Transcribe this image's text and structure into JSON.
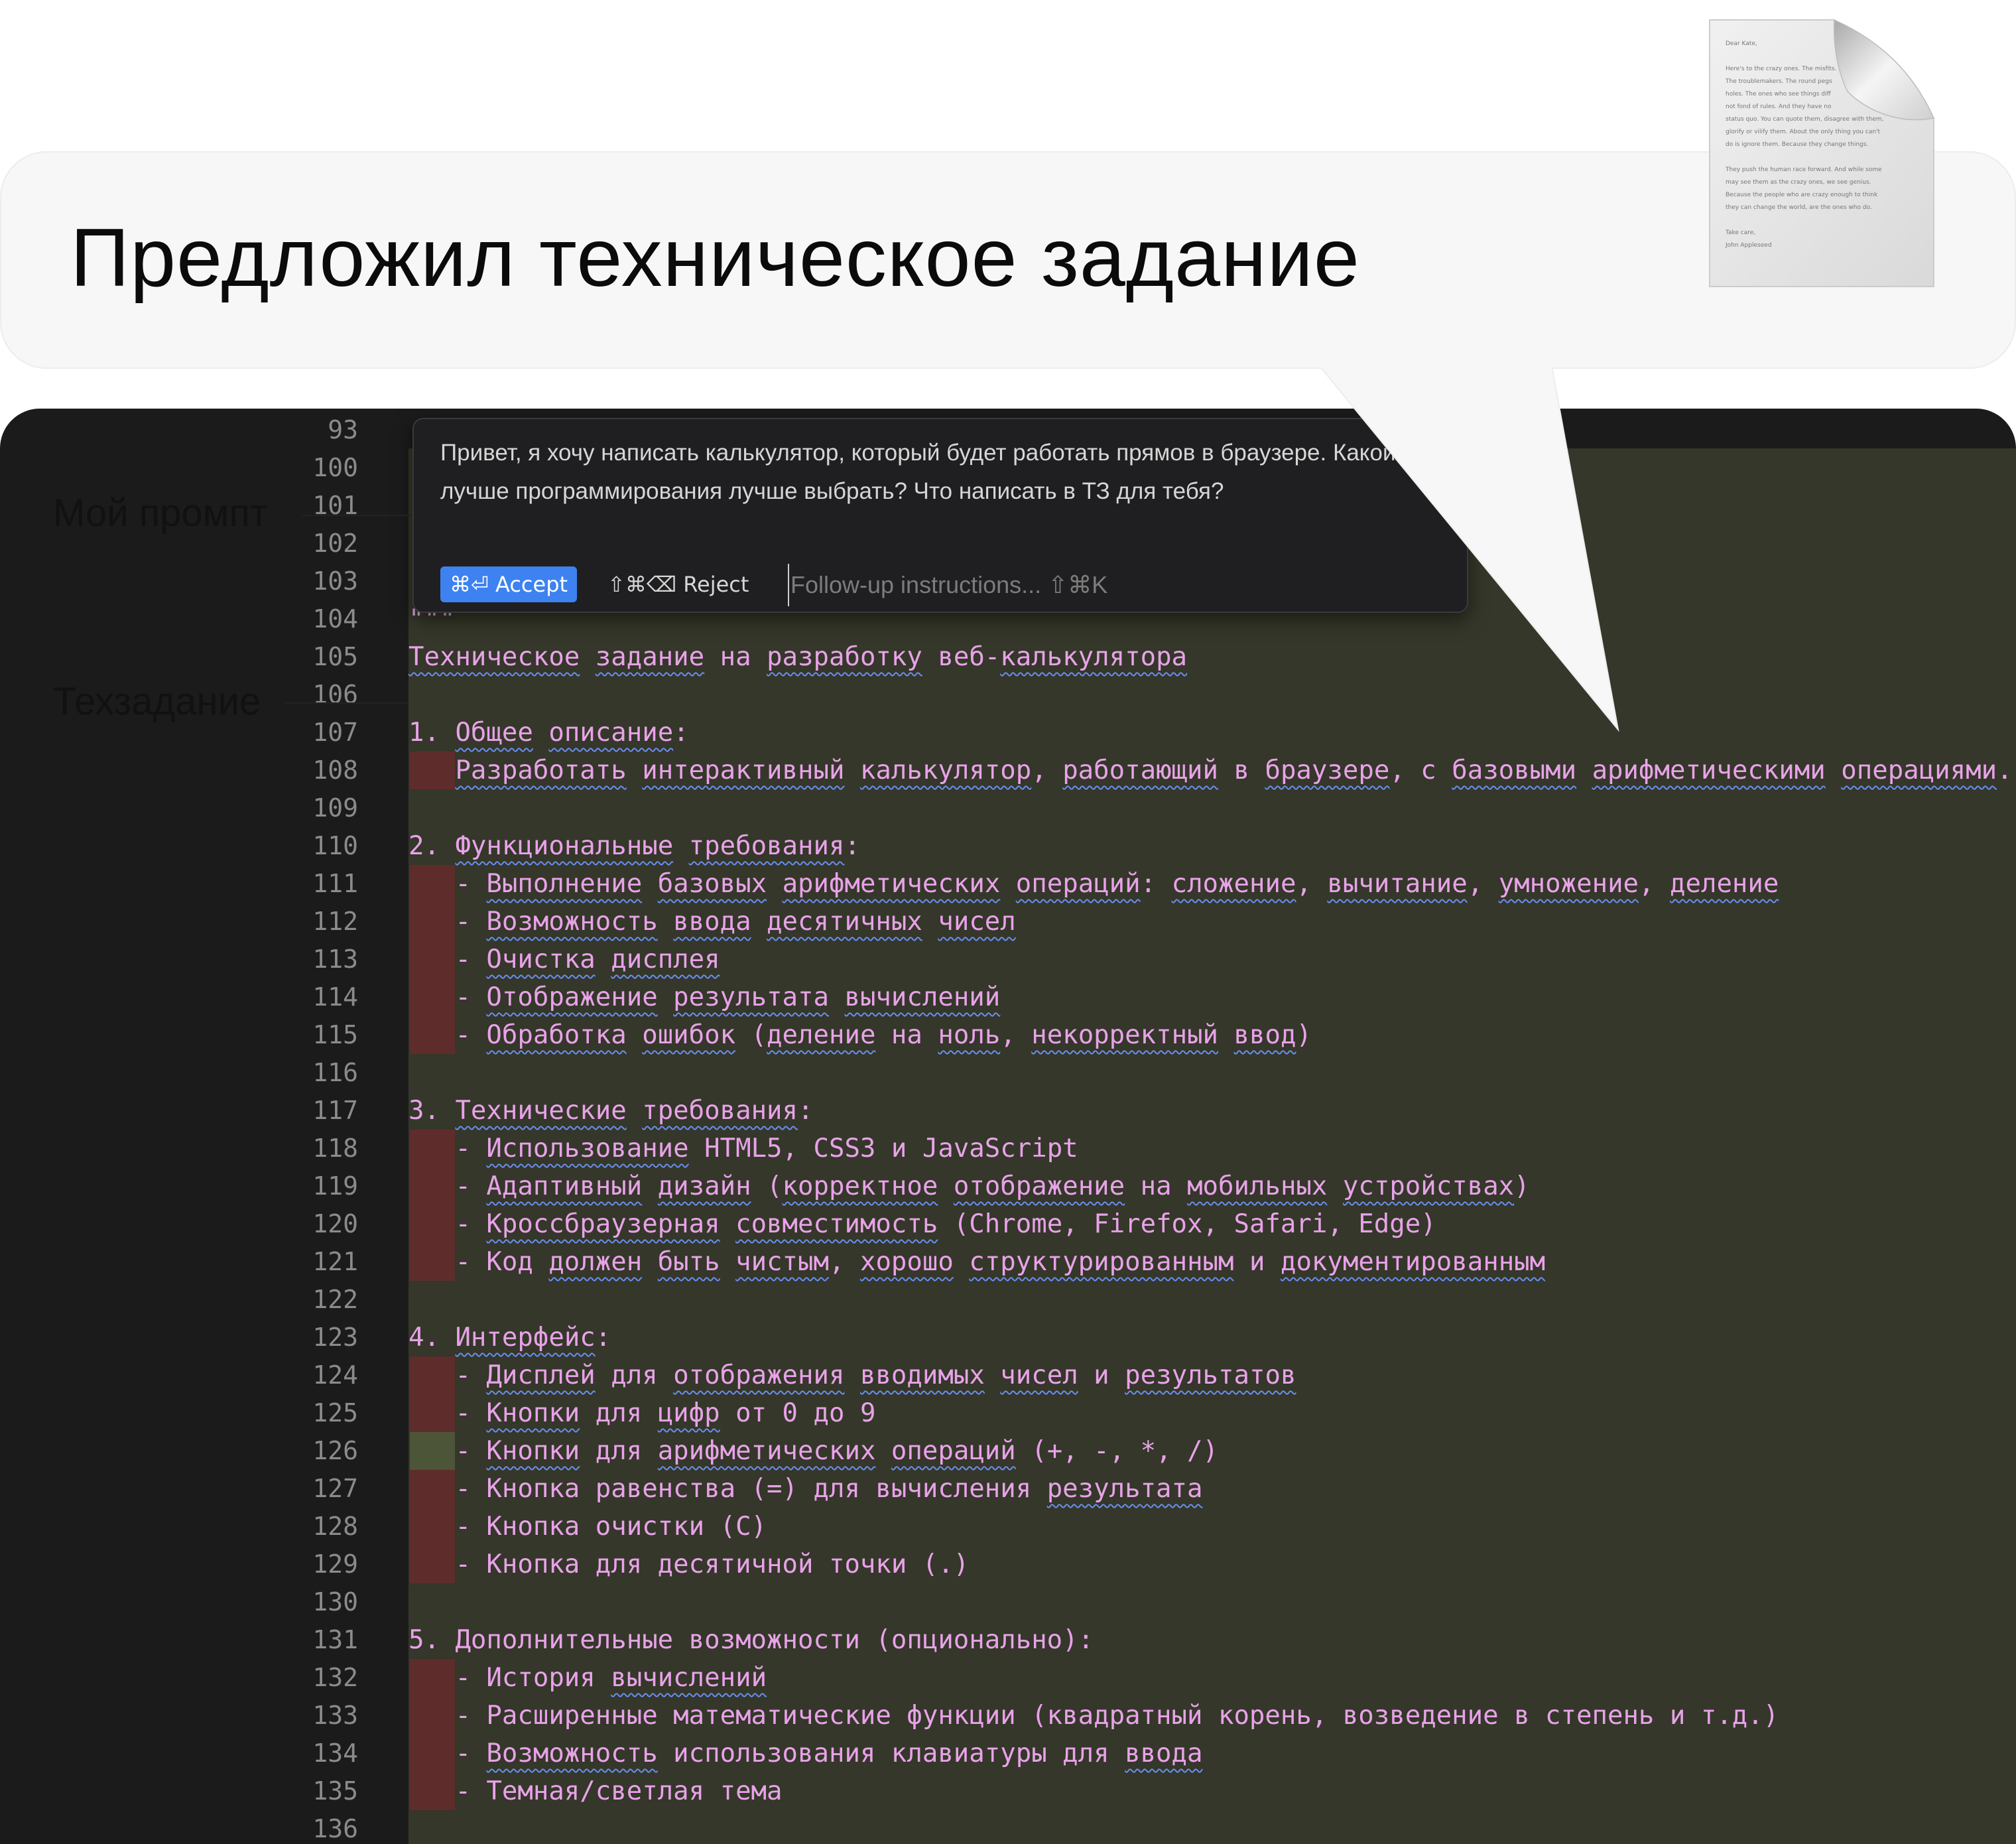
{
  "headline": "Предложил техническое задание",
  "document_icon": {
    "name": "document-icon",
    "lines": [
      "Dear Kate,",
      "",
      "Here's to the crazy ones. The misfits.",
      "The troublemakers. The round pegs",
      "holes. The ones who see things diff",
      "not fond of rules. And they have no",
      "status quo. You can quote them, disagree with them,",
      "glorify or vilify them. About the only thing you can't",
      "do is ignore them. Because they change things.",
      "",
      "They push the human race forward. And while some",
      "may see them as the crazy ones, we see genius.",
      "Because the people who are crazy enough to think",
      "they can change the world, are the ones who do.",
      "",
      "Take care,",
      "John Appleseed"
    ]
  },
  "annotations": {
    "prompt_label": "Мой промпт",
    "spec_label": "Техзадание"
  },
  "prompt_dialog": {
    "text": "Привет, я хочу написать калькулятор, который будет работать прямов в браузере. Какой язык лучше программирования лучше выбрать? Что написать в ТЗ для тебя?",
    "accept_label": "⌘⏎ Accept",
    "reject_label": "⇧⌘⌫ Reject",
    "followup_placeholder": "Follow-up instructions... ⇧⌘K"
  },
  "editor": {
    "line_numbers": [
      "93",
      "100",
      "101",
      "102",
      "103",
      "104",
      "105",
      "106",
      "107",
      "108",
      "109",
      "110",
      "111",
      "112",
      "113",
      "114",
      "115",
      "116",
      "117",
      "118",
      "119",
      "120",
      "121",
      "122",
      "123",
      "124",
      "125",
      "126",
      "127",
      "128",
      "129",
      "130",
      "131",
      "132",
      "133",
      "134",
      "135",
      "136"
    ],
    "code_lines": [
      {
        "ln": "104",
        "text": "\"\"\"",
        "marker": ""
      },
      {
        "ln": "105",
        "text": "Техническое задание на разработку веб-калькулятора",
        "marker": ""
      },
      {
        "ln": "106",
        "text": "",
        "marker": ""
      },
      {
        "ln": "107",
        "text": "1. Общее описание:",
        "marker": ""
      },
      {
        "ln": "108",
        "text": "   Разработать интерактивный калькулятор, работающий в браузере, с базовыми арифметическими операциями.",
        "marker": "red"
      },
      {
        "ln": "109",
        "text": "",
        "marker": ""
      },
      {
        "ln": "110",
        "text": "2. Функциональные требования:",
        "marker": ""
      },
      {
        "ln": "111",
        "text": "   - Выполнение базовых арифметических операций: сложение, вычитание, умножение, деление",
        "marker": "red"
      },
      {
        "ln": "112",
        "text": "   - Возможность ввода десятичных чисел",
        "marker": "red"
      },
      {
        "ln": "113",
        "text": "   - Очистка дисплея",
        "marker": "red"
      },
      {
        "ln": "114",
        "text": "   - Отображение результата вычислений",
        "marker": "red"
      },
      {
        "ln": "115",
        "text": "   - Обработка ошибок (деление на ноль, некорректный ввод)",
        "marker": "red"
      },
      {
        "ln": "116",
        "text": "",
        "marker": ""
      },
      {
        "ln": "117",
        "text": "3. Технические требования:",
        "marker": ""
      },
      {
        "ln": "118",
        "text": "   - Использование HTML5, CSS3 и JavaScript",
        "marker": "red"
      },
      {
        "ln": "119",
        "text": "   - Адаптивный дизайн (корректное отображение на мобильных устройствах)",
        "marker": "red"
      },
      {
        "ln": "120",
        "text": "   - Кроссбраузерная совместимость (Chrome, Firefox, Safari, Edge)",
        "marker": "red"
      },
      {
        "ln": "121",
        "text": "   - Код должен быть чистым, хорошо структурированным и документированным",
        "marker": "red"
      },
      {
        "ln": "122",
        "text": "",
        "marker": ""
      },
      {
        "ln": "123",
        "text": "4. Интерфейс:",
        "marker": ""
      },
      {
        "ln": "124",
        "text": "   - Дисплей для отображения вводимых чисел и результатов",
        "marker": "red"
      },
      {
        "ln": "125",
        "text": "   - Кнопки для цифр от 0 до 9",
        "marker": "red"
      },
      {
        "ln": "126",
        "text": "   - Кнопки для арифметических операций (+, -, *, /)",
        "marker": "green"
      },
      {
        "ln": "127",
        "text": "   - Кнопка равенства (=) для вычисления результата",
        "marker": "red"
      },
      {
        "ln": "128",
        "text": "   - Кнопка очистки (C)",
        "marker": "red"
      },
      {
        "ln": "129",
        "text": "   - Кнопка для десятичной точки (.)",
        "marker": "red"
      },
      {
        "ln": "130",
        "text": "",
        "marker": ""
      },
      {
        "ln": "131",
        "text": "5. Дополнительные возможности (опционально):",
        "marker": ""
      },
      {
        "ln": "132",
        "text": "   - История вычислений",
        "marker": "red"
      },
      {
        "ln": "133",
        "text": "   - Расширенные математические функции (квадратный корень, возведение в степень и т.д.)",
        "marker": "red"
      },
      {
        "ln": "134",
        "text": "   - Возможность использования клавиатуры для ввода",
        "marker": "red"
      },
      {
        "ln": "135",
        "text": "   - Темная/светлая тема",
        "marker": "red"
      }
    ],
    "squiggly_words": [
      "Техническое",
      "задание",
      "разработку",
      "калькулятора",
      "Общее",
      "описание",
      "Разработать",
      "интерактивный",
      "калькулятор",
      "работающий",
      "браузере",
      "базовыми",
      "арифметическими",
      "операциями",
      "Функциональные",
      "требования",
      "Выполнение",
      "базовых",
      "арифметических",
      "операций",
      "сложение",
      "вычитание",
      "умножение",
      "деление",
      "Возможность",
      "ввода",
      "десятичных",
      "чисел",
      "Очистка",
      "дисплея",
      "Отображение",
      "результата",
      "вычислений",
      "Обработка",
      "ошибок",
      "ноль",
      "некорректный",
      "ввод",
      "Технические",
      "Использование",
      "Адаптивный",
      "дизайн",
      "корректное",
      "отображение",
      "мобильных",
      "устройствах",
      "Кроссбраузерная",
      "совместимость",
      "должен",
      "быть",
      "чистым",
      "хорошо",
      "структурированным",
      "документированным",
      "Интерфейс",
      "Дисплей",
      "отображения",
      "вводимых",
      "результатов",
      "Кнопки",
      "цифр"
    ],
    "colors": {
      "editor_bg": "#1b1b1b",
      "code_bg": "#343729",
      "code_text": "#e8a2e8",
      "line_number": "#8b8b8b",
      "deleted_marker": "#5e2d2b",
      "modified_marker": "#4c5538",
      "accept_button": "#3d82f0",
      "squiggle": "#6a8df0"
    }
  }
}
